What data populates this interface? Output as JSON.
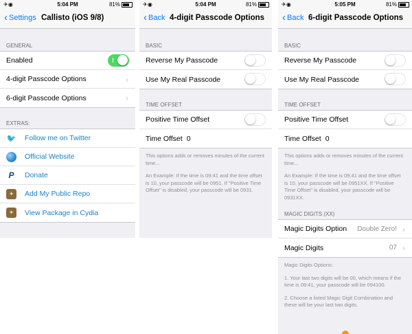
{
  "status": {
    "carrier_glyph": "✈ ◉",
    "battery": "81%"
  },
  "screens": [
    {
      "time": "5:04 PM",
      "back": "Settings",
      "title": "Callisto (iOS 9/8)",
      "general_header": "GENERAL",
      "enabled": "Enabled",
      "enabled_on": true,
      "opt4": "4-digit Passcode Options",
      "opt6": "6-digit Passcode Options",
      "extras_header": "EXTRAS:",
      "links": [
        {
          "label": "Follow me on Twitter",
          "icon": "twitter-icon"
        },
        {
          "label": "Official Website",
          "icon": "globe-icon"
        },
        {
          "label": "Donate",
          "icon": "paypal-icon"
        },
        {
          "label": "Add My Public Repo",
          "icon": "cydia-icon"
        },
        {
          "label": "View Package in Cydia",
          "icon": "cydia-icon"
        }
      ]
    },
    {
      "time": "5:04 PM",
      "back": "Back",
      "title": "4-digit Passcode Options",
      "basic_header": "BASIC",
      "reverse": "Reverse My Passcode",
      "real": "Use My Real Passcode",
      "offset_header": "TIME OFFSET",
      "positive": "Positive Time Offset",
      "offset_label": "Time Offset",
      "offset_value": "0",
      "foot1": "This options adds or removes minutes of the current time...",
      "foot2": "An Example: If the time is 09:41 and the time offset is 10, your passcode will be 0951. If \"Positive Time Offset\" is disabled, your passcode will be 0931."
    },
    {
      "time": "5:05 PM",
      "back": "Back",
      "title": "6-digit Passcode Options",
      "basic_header": "BASIC",
      "reverse": "Reverse My Passcode",
      "real": "Use My Real Passcode",
      "offset_header": "TIME OFFSET",
      "positive": "Positive Time Offset",
      "offset_label": "Time Offset",
      "offset_value": "0",
      "foot1": "This options adds or removes minutes of the current time...",
      "foot2": "An Example: If the time is 09:41 and the time offset is 10, your passcode will be 0951XX. If \"Positive Time Offset\" is disabled, your passcode will be 0931XX.",
      "magic_header": "MAGIC DIGITS (XX)",
      "magic_option": "Magic Digits Option",
      "magic_option_value": "Double Zero!",
      "magic_digits": "Magic Digits",
      "magic_digits_value": "07",
      "magic_foot_title": "Magic Digits Options:",
      "magic_foot1": "1. Your last two digits will be 00, which means if the time is 09:41, your passcode will be 094100.",
      "magic_foot2": "2. Choose a listed Magic Digit Combination and these will be your last two digits."
    }
  ],
  "colors": {
    "accent": "#007aff",
    "toggle_on": "#4cd964",
    "background": "#efeff4"
  }
}
